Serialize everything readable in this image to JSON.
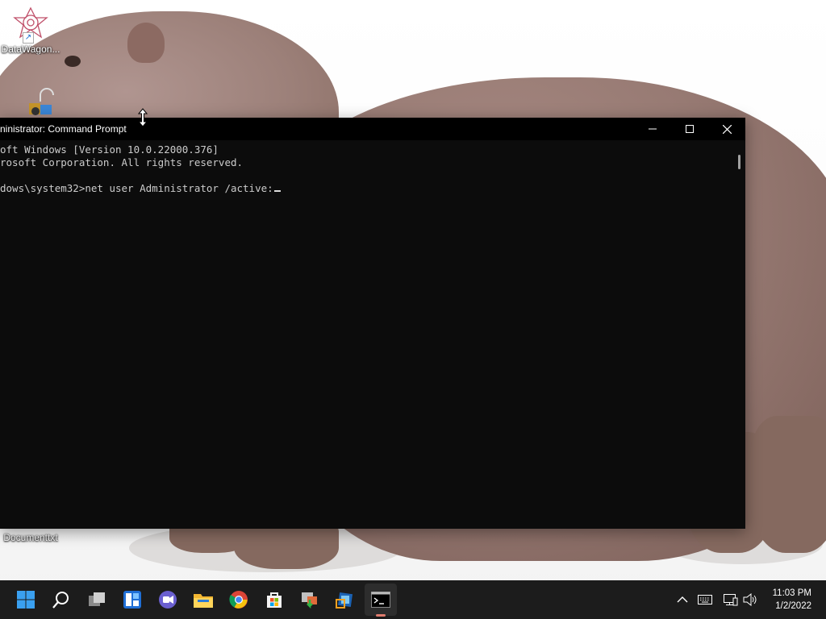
{
  "desktop": {
    "icons": [
      {
        "label": "DataWagon..."
      },
      {
        "label": ""
      },
      {
        "label": "Documenttxt"
      }
    ]
  },
  "cmd_window": {
    "title": "ninistrator: Command Prompt",
    "lines": [
      "oft Windows [Version 10.0.22000.376]",
      "rosoft Corporation. All rights reserved.",
      "",
      "dows\\system32>net user Administrator /active:"
    ],
    "controls": {
      "minimize": "minimize",
      "maximize": "maximize",
      "close": "close"
    }
  },
  "taskbar": {
    "apps": [
      {
        "name": "start"
      },
      {
        "name": "search"
      },
      {
        "name": "task-view"
      },
      {
        "name": "widgets"
      },
      {
        "name": "teams-chat"
      },
      {
        "name": "file-explorer"
      },
      {
        "name": "chrome"
      },
      {
        "name": "microsoft-store"
      },
      {
        "name": "installer"
      },
      {
        "name": "virtualbox"
      },
      {
        "name": "command-prompt",
        "active": true
      }
    ],
    "clock": {
      "time": "11:03 PM",
      "date": "1/2/2022"
    }
  },
  "colors": {
    "taskbar_bg": "#1c1c1c",
    "cmd_bg": "#0c0c0c",
    "cmd_text": "#cccccc"
  }
}
